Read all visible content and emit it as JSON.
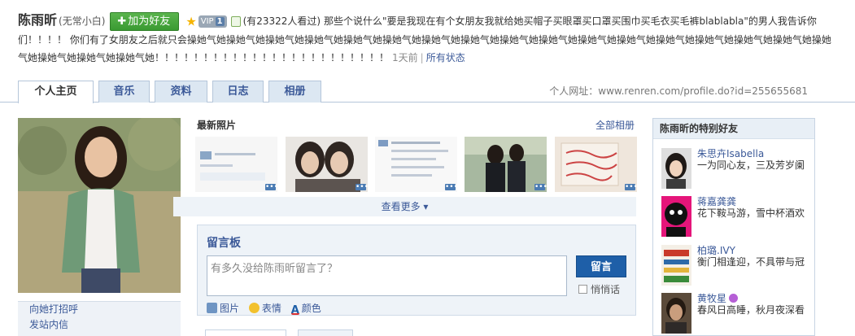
{
  "header": {
    "name": "陈雨昕",
    "nickname": "(无常小白)",
    "add_friend_label": "加为好友",
    "vip_label": "VIP",
    "vip_level": "1",
    "view_count_text": "(有23322人看过)",
    "status_text": "那些个说什么\"要是我现在有个女朋友我就给她买帽子买眼罩买口罩买围巾买毛衣买毛裤blablabla\"的男人我告诉你们！！！！ 你们有了女朋友之后就只会操她气她操她气她操她气她操她气她操她气她操她气她操她气她操她气她操她气她操她气她操她气她操她气她操她气她操她气她操她气她操她气她操她气她操她气她操她气她操她气她！！！！！！！！！！！！！！！！！！！！！！！！",
    "status_time": "1天前",
    "all_status_label": "所有状态"
  },
  "tabs": [
    {
      "label": "个人主页",
      "active": true
    },
    {
      "label": "音乐",
      "active": false
    },
    {
      "label": "资料",
      "active": false
    },
    {
      "label": "日志",
      "active": false
    },
    {
      "label": "相册",
      "active": false
    }
  ],
  "profile_url_label": "个人网址：",
  "profile_url": "www.renren.com/profile.do?id=255655681",
  "left_actions": [
    "向她打招呼",
    "发站内信"
  ],
  "photos": {
    "title": "最新照片",
    "all_label": "全部相册",
    "see_more_label": "查看更多",
    "more_badge": "•••"
  },
  "board": {
    "title": "留言板",
    "placeholder": "有多久没给陈雨昕留言了？",
    "submit_label": "留言",
    "whisper_label": "悄悄话",
    "tools": [
      "图片",
      "表情",
      "颜色"
    ]
  },
  "friends": {
    "title": "陈雨昕的特别好友",
    "items": [
      {
        "name": "朱思卉Isabella",
        "status": "一为同心友，三及芳岁阑"
      },
      {
        "name": "蒋嘉龚龚",
        "status": "花下鞍马游，雪中杯酒欢"
      },
      {
        "name": "柏璐.IVY",
        "status": "衡门相逢迎，不具带与冠"
      },
      {
        "name": "黄牧星",
        "status": "春风日高睡，秋月夜深看"
      }
    ]
  },
  "colors": {
    "link": "#3b5998",
    "add_friend_green": "#3a9a32",
    "submit_blue": "#1e5fa8",
    "tab_bg": "#dce7f2"
  }
}
